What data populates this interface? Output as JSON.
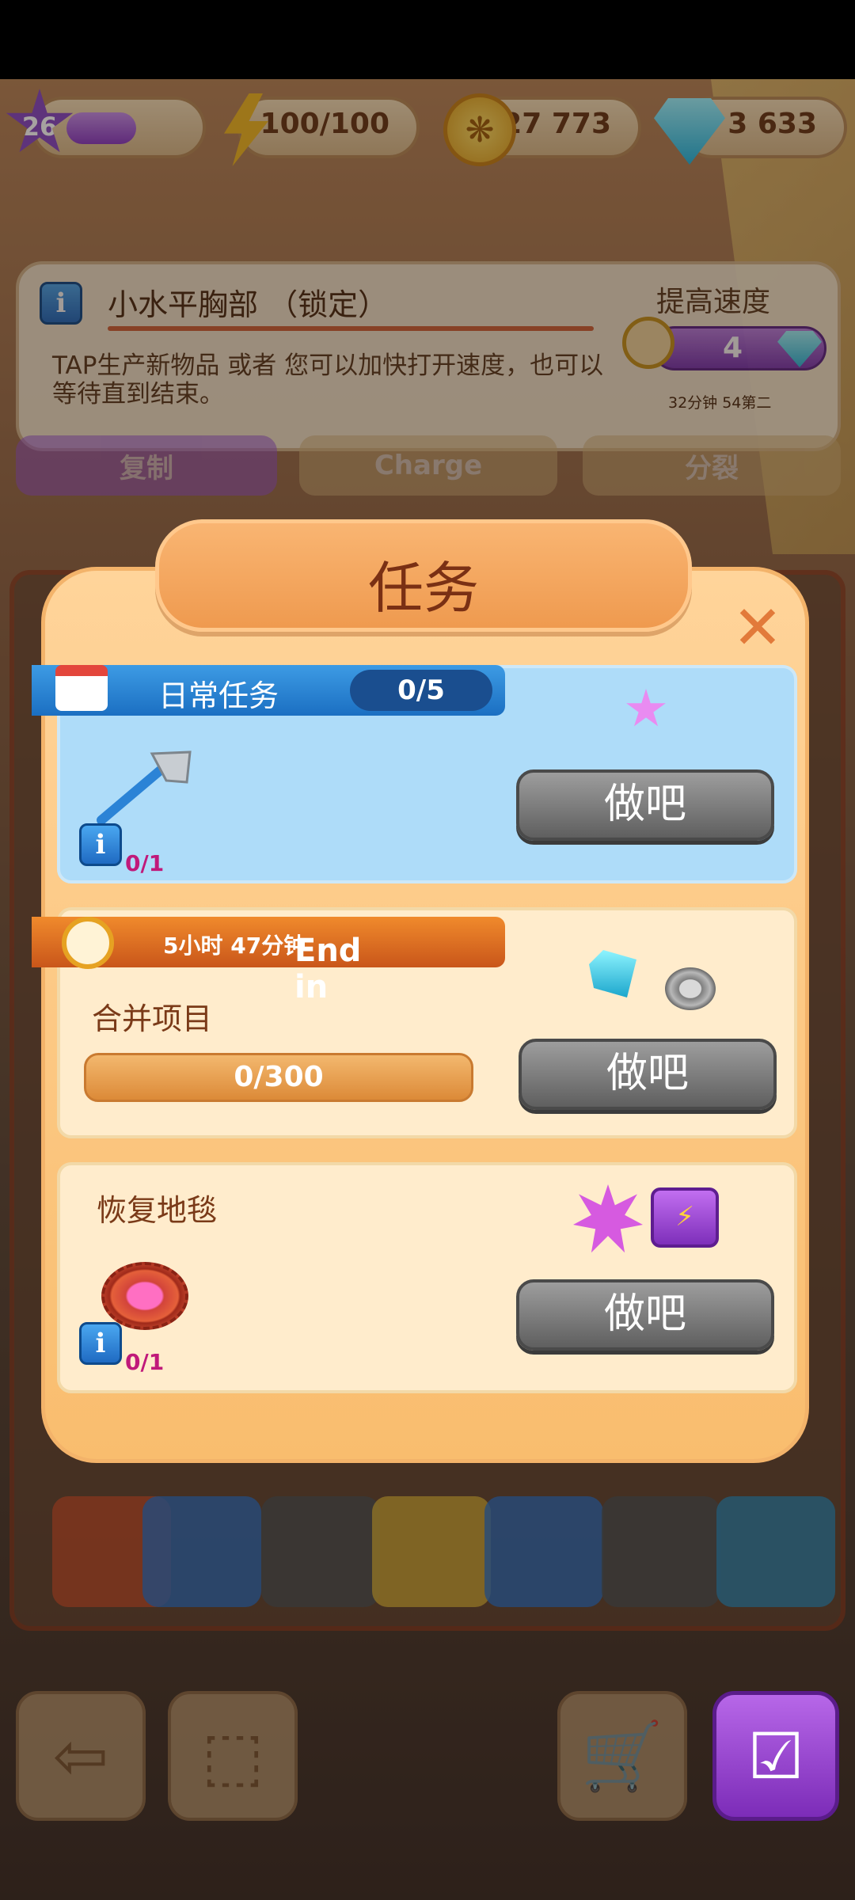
{
  "top_bar": {
    "level": "26",
    "level_progress": 0.4,
    "energy": "100/100",
    "coins": "27 773",
    "gems": "3 633"
  },
  "info_panel": {
    "title": "小水平胸部 （锁定）",
    "description": "TAP生产新物品 或者 您可以加快打开速度，也可以等待直到结束。",
    "speed_label": "提高速度",
    "speed_cost": "4",
    "time_left": "32分钟 54第二"
  },
  "behind_buttons": [
    "复制",
    "Charge",
    "分裂"
  ],
  "dialog": {
    "title": "任务",
    "daily": {
      "label": "日常任务",
      "count": "0/5",
      "item_count": "0/1",
      "button": "做吧"
    },
    "event": {
      "end_in": "End in",
      "time": "5小时 47分钟",
      "task": "合并项目",
      "progress": "0/300",
      "button": "做吧"
    },
    "rug": {
      "task": "恢复地毯",
      "item_count": "0/1",
      "button": "做吧"
    }
  },
  "icons": [
    "star-icon",
    "lightning-icon",
    "coin-icon",
    "gem-icon",
    "info-icon",
    "stopwatch-icon",
    "close-icon",
    "calendar-icon",
    "axe-icon",
    "alarm-clock-icon",
    "crystal-icon",
    "coil-icon",
    "rug-icon",
    "sparkle-icon",
    "energy-box-icon",
    "back-icon",
    "box-icon",
    "cart-icon",
    "quests-icon"
  ],
  "colors": {
    "accent_orange": "#f3a35c",
    "daily_blue": "#aedcf9",
    "button_gray": "#6f6f6f",
    "counter_magenta": "#c0197a",
    "quests_purple": "#9b46d6"
  }
}
